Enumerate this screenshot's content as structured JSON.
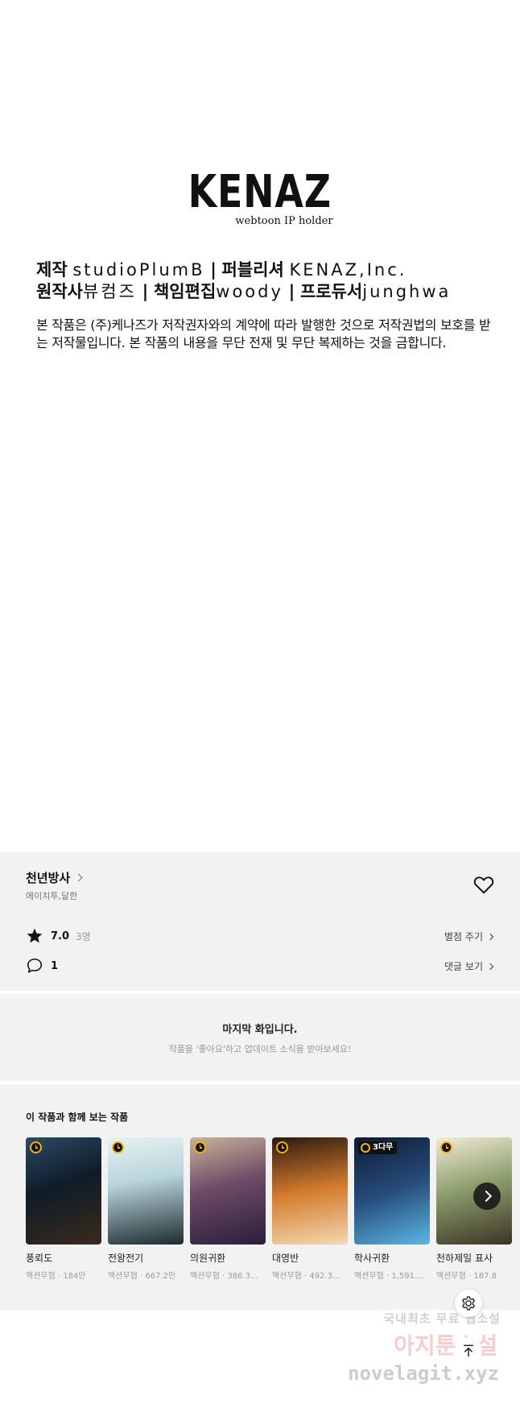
{
  "credits": {
    "logo": "KENAZ",
    "logo_sub": "webtoon IP holder",
    "line1": {
      "k1": "제작",
      "v1": "studioPlumB",
      "sep": "|",
      "k2": "퍼블리셔",
      "v2": "KENAZ,Inc."
    },
    "line2": {
      "k1": "원작사",
      "v1": "뷰컴즈",
      "sep": "|",
      "k2": "책임편집",
      "v2": "woody",
      "k3": "프로듀서",
      "v3": "junghwa"
    },
    "notice": "본 작품은 (주)케나즈가 저작권자와의 계약에 따라 발행한 것으로 저작권법의 보호를 받는 저작물입니다. 본 작품의 내용을 무단 전재 및 무단 복제하는 것을 금합니다."
  },
  "series": {
    "title": "천년방사",
    "authors": "에이치투,달한",
    "rating": "7.0",
    "rating_count": "3명",
    "rate_label": "별점 주기",
    "comment_count": "1",
    "comment_label": "댓글 보기"
  },
  "last_episode": {
    "title": "마지막 화입니다.",
    "subtitle": "작품을 '좋아요'하고 업데이트 소식을 받아보세요!"
  },
  "recommendations": {
    "heading": "이 작품과 함께 보는 작품",
    "items": [
      {
        "title": "풍뢰도",
        "meta": "액션무협 · 184만",
        "badge": "clock"
      },
      {
        "title": "전왕전기",
        "meta": "액션무협 · 667.2만",
        "badge": "clock"
      },
      {
        "title": "의원귀환",
        "meta": "액션무협 · 386.3...",
        "badge": "clock"
      },
      {
        "title": "대영반",
        "meta": "액션무협 · 492.3...",
        "badge": "clock"
      },
      {
        "title": "학사귀환",
        "meta": "액션무협 · 1,591....",
        "badge": "3다무"
      },
      {
        "title": "천하제일 표사",
        "meta": "액션무협 · 187.8",
        "badge": "clock"
      }
    ]
  },
  "watermark": {
    "line1": "국내최초 무료 웹소설",
    "line2": "아지툰소설",
    "line3": "novelagit.xyz"
  },
  "colors": {
    "panel_bg": "#f2f2f2",
    "badge_accent": "#f3b400"
  }
}
